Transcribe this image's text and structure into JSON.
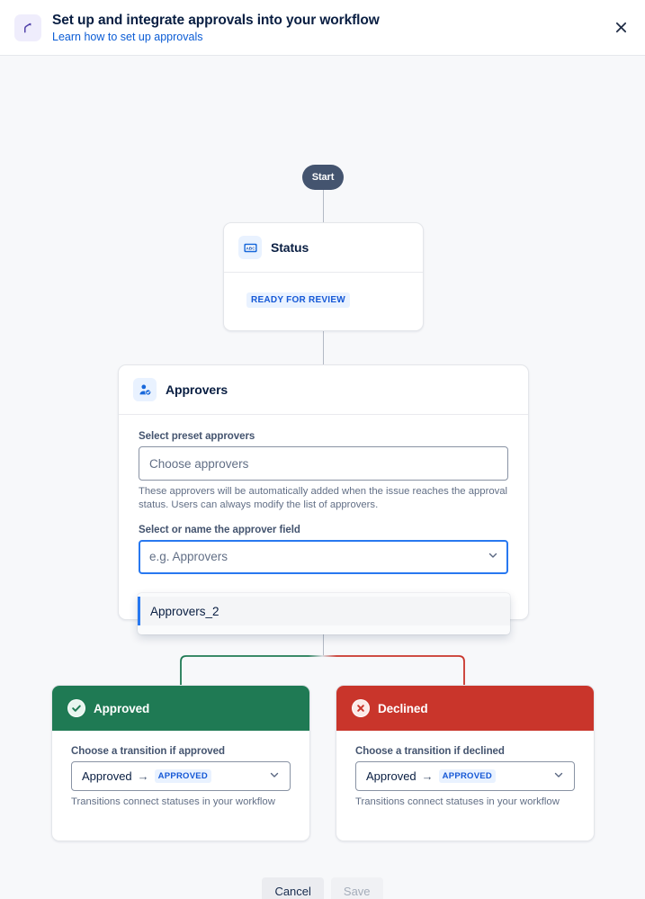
{
  "header": {
    "icon": "workflow-branch-icon",
    "title": "Set up and integrate approvals into your workflow",
    "link_label": "Learn how to set up approvals",
    "close_icon": "close-icon"
  },
  "flow": {
    "start_label": "Start",
    "status_card": {
      "icon": "abc-text-field-icon",
      "title": "Status",
      "status_badge": "READY FOR REVIEW"
    },
    "approvers_card": {
      "icon": "approver-person-check-icon",
      "title": "Approvers",
      "preset_label": "Select preset approvers",
      "preset_placeholder": "Choose approvers",
      "preset_value": "",
      "preset_help": "These approvers will be automatically added when the issue reaches the approval status. Users can always modify the list of approvers.",
      "field_label": "Select or name the approver field",
      "field_placeholder": "e.g. Approvers",
      "field_value": "",
      "chevron_icon": "chevron-down-icon",
      "dropdown": {
        "options": [
          "Approvers_2"
        ]
      }
    },
    "approved_card": {
      "icon": "check-circle-icon",
      "title": "Approved",
      "transition_label": "Choose a transition if approved",
      "transition_from": "Approved",
      "transition_arrow": "→",
      "transition_to_badge": "APPROVED",
      "transition_help": "Transitions connect statuses in your workflow",
      "chevron_icon": "chevron-down-icon",
      "accent_color": "#1f7a54"
    },
    "declined_card": {
      "icon": "cross-circle-icon",
      "title": "Declined",
      "transition_label": "Choose a transition if declined",
      "transition_from": "Approved",
      "transition_arrow": "→",
      "transition_to_badge": "APPROVED",
      "transition_help": "Transitions connect statuses in your workflow",
      "chevron_icon": "chevron-down-icon",
      "accent_color": "#c9352b"
    }
  },
  "footer": {
    "cancel_label": "Cancel",
    "save_label": "Save"
  }
}
